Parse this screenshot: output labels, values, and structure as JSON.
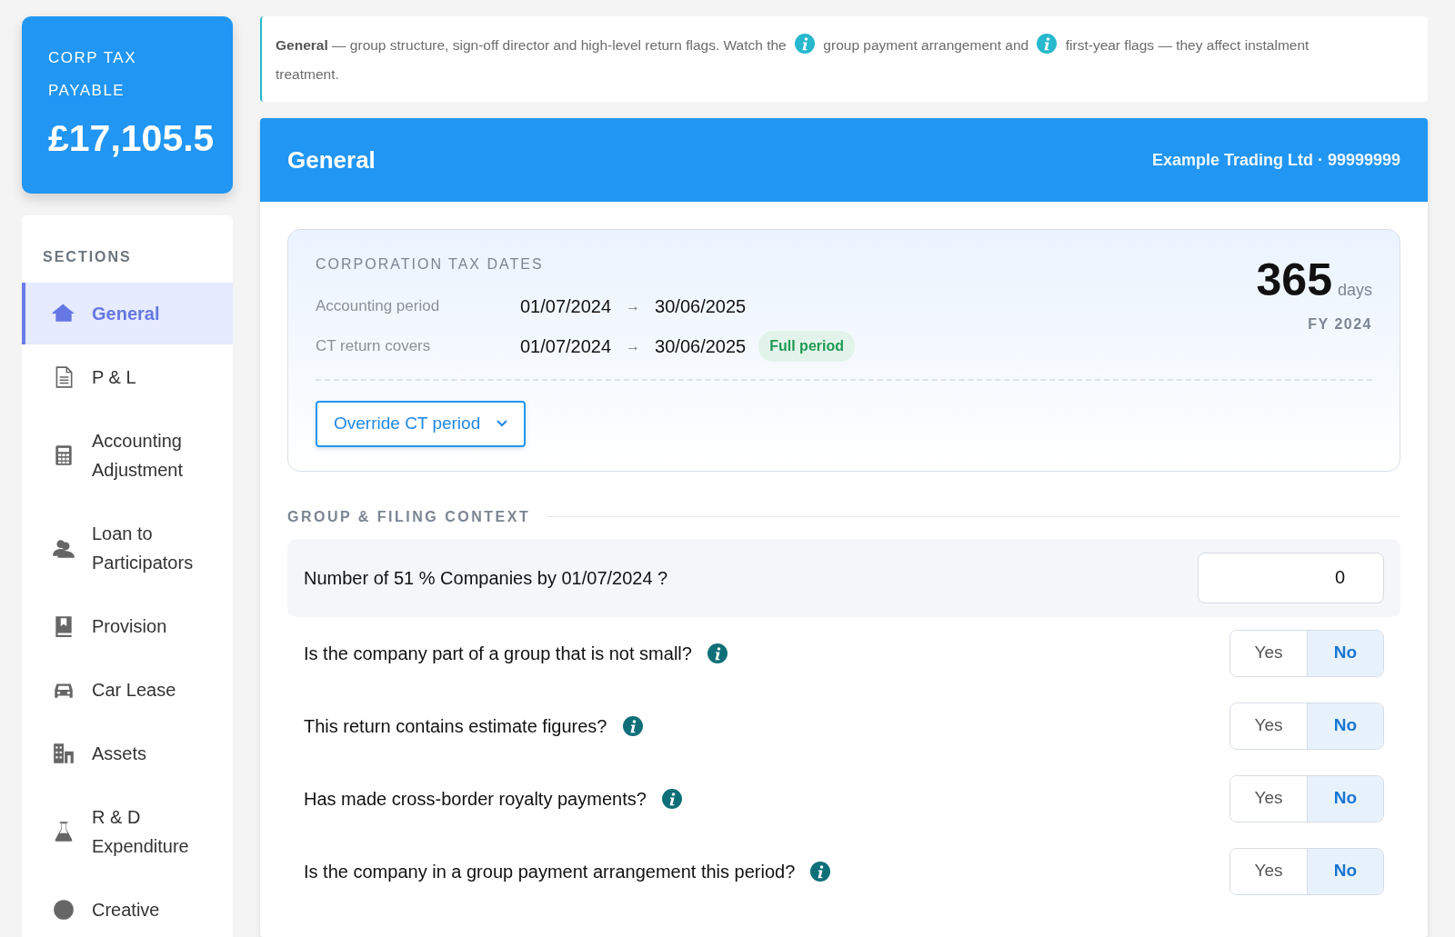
{
  "summary": {
    "label": "CORP TAX PAYABLE",
    "amount": "£17,105.5"
  },
  "sidebar": {
    "heading": "SECTIONS",
    "items": [
      {
        "label": "General",
        "selected": true
      },
      {
        "label": "P & L",
        "selected": false
      },
      {
        "label": "Accounting Adjustment",
        "selected": false
      },
      {
        "label": "Loan to Participators",
        "selected": false
      },
      {
        "label": "Provision",
        "selected": false
      },
      {
        "label": "Car Lease",
        "selected": false
      },
      {
        "label": "Assets",
        "selected": false
      },
      {
        "label": "R & D Expenditure",
        "selected": false
      },
      {
        "label": "Creative",
        "selected": false
      }
    ]
  },
  "note": {
    "parts": [
      {
        "kind": "text",
        "text": "**General** — group structure, sign-off director and high-level return flags. Watch the"
      },
      {
        "kind": "icon"
      },
      {
        "kind": "text",
        "text": "group payment arrangement and"
      },
      {
        "kind": "icon"
      },
      {
        "kind": "text",
        "text": "first-year flags — they affect instalment"
      },
      {
        "kind": "text",
        "text": "treatment."
      }
    ]
  },
  "panel": {
    "title": "General",
    "company": "Example Trading Ltd · 99999999"
  },
  "dates": {
    "heading": "CORPORATION TAX DATES",
    "rows": [
      {
        "label": "Accounting period",
        "start": "01/07/2024",
        "arrow": "→",
        "end": "30/06/2025"
      },
      {
        "label": "CT return covers",
        "start": "01/07/2024",
        "arrow": "→",
        "end": "30/06/2025",
        "badge": "Full period"
      }
    ],
    "days": "365",
    "days_unit": "days",
    "fy": "FY 2024",
    "override_button": "Override CT period"
  },
  "group": {
    "heading": "GROUP & FILING CONTEXT",
    "count_question": {
      "text": "Number of 51 % Companies by 01/07/2024 ?",
      "value": "0"
    },
    "questions": [
      {
        "text": "Is the company part of a group that is not small?",
        "options": [
          {
            "label": "Yes",
            "selected": false
          },
          {
            "label": "No",
            "selected": true
          }
        ]
      },
      {
        "text": "This return contains estimate figures?",
        "options": [
          {
            "label": "Yes",
            "selected": false
          },
          {
            "label": "No",
            "selected": true
          }
        ]
      },
      {
        "text": "Has made cross-border royalty payments?",
        "options": [
          {
            "label": "Yes",
            "selected": false
          },
          {
            "label": "No",
            "selected": true
          }
        ]
      },
      {
        "text": "Is the company in a group payment arrangement this period?",
        "options": [
          {
            "label": "Yes",
            "selected": false
          },
          {
            "label": "No",
            "selected": true
          }
        ]
      }
    ]
  }
}
